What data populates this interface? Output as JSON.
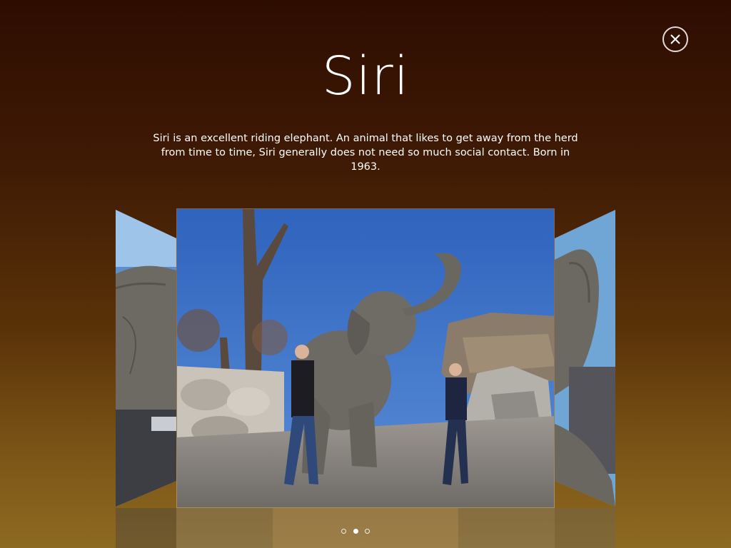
{
  "header": {
    "title": "Siri",
    "description": "Siri is an excellent riding elephant. An animal that likes to get away from the herd from time to time, Siri generally does not need so much social contact. Born in 1963."
  },
  "close_button": {
    "icon": "close-icon"
  },
  "carousel": {
    "active_index": 1,
    "slide_count": 3,
    "slides": [
      {
        "image": "elephant-side-photo"
      },
      {
        "image": "elephant-with-people-photo"
      },
      {
        "image": "elephant-trunk-raised-photo"
      }
    ]
  },
  "colors": {
    "background_top": "#2e0d01",
    "background_bottom": "#8d6a22",
    "sky": "#3a6fc4",
    "elephant": "#6b6761",
    "ground": "#8a8580"
  }
}
